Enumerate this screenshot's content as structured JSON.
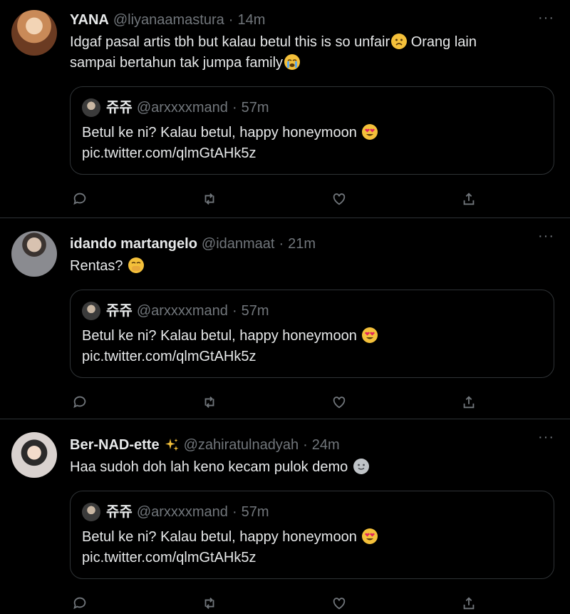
{
  "colors": {
    "background": "#000000",
    "text": "#e7e9ea",
    "muted": "#71767b",
    "border": "#2f3336"
  },
  "icons": {
    "reply": "reply-icon",
    "retweet": "retweet-icon",
    "like": "heart-icon",
    "share": "share-icon",
    "more": "more-icon",
    "sparkles": "sparkles-icon"
  },
  "tweets": [
    {
      "name": "YANA",
      "handle": "@liyanaamastura",
      "dot": "·",
      "time": "14m",
      "more": "···",
      "text_line1": "Idgaf pasal artis tbh but kalau betul this is so unfair",
      "text_line1b": " Orang lain",
      "text_line2": "sampai bertahun tak jumpa family",
      "quote": {
        "name": "쥬쥬",
        "handle": "@arxxxxmand",
        "dot": "·",
        "time": "57m",
        "text": "Betul ke ni? Kalau betul, happy honeymoon ",
        "link": "pic.twitter.com/qlmGtAHk5z"
      }
    },
    {
      "name": "idando martangelo",
      "handle": "@idanmaat",
      "dot": "·",
      "time": "21m",
      "more": "···",
      "text": "Rentas? ",
      "quote": {
        "name": "쥬쥬",
        "handle": "@arxxxxmand",
        "dot": "·",
        "time": "57m",
        "text": "Betul ke ni? Kalau betul, happy honeymoon ",
        "link": "pic.twitter.com/qlmGtAHk5z"
      }
    },
    {
      "name": "Ber-NAD-ette",
      "handle": "@zahiratulnadyah",
      "dot": "·",
      "time": "24m",
      "more": "···",
      "text": "Haa sudoh doh lah keno kecam pulok demo ",
      "quote": {
        "name": "쥬쥬",
        "handle": "@arxxxxmand",
        "dot": "·",
        "time": "57m",
        "text": "Betul ke ni? Kalau betul, happy honeymoon ",
        "link": "pic.twitter.com/qlmGtAHk5z"
      }
    }
  ]
}
